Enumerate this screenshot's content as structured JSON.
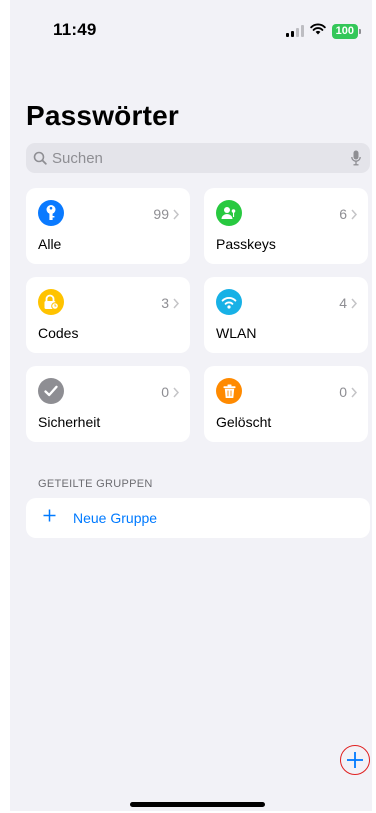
{
  "status_bar": {
    "time": "11:49",
    "battery": "100"
  },
  "title": "Passwörter",
  "search": {
    "placeholder": "Suchen"
  },
  "categories": [
    {
      "label": "Alle",
      "count": "99",
      "icon": "key-icon",
      "color": "#0a7aff"
    },
    {
      "label": "Passkeys",
      "count": "6",
      "icon": "passkey-person-icon",
      "color": "#28c940"
    },
    {
      "label": "Codes",
      "count": "3",
      "icon": "lock-clock-icon",
      "color": "#ffc300"
    },
    {
      "label": "WLAN",
      "count": "4",
      "icon": "wifi-icon",
      "color": "#17b1e6"
    },
    {
      "label": "Sicherheit",
      "count": "0",
      "icon": "checkmark-icon",
      "color": "#8e8e93"
    },
    {
      "label": "Gelöscht",
      "count": "0",
      "icon": "trash-icon",
      "color": "#ff8a00"
    }
  ],
  "shared_groups": {
    "header": "GETEILTE GRUPPEN",
    "new_group_label": "Neue Gruppe"
  },
  "colors": {
    "accent": "#007aff",
    "background": "#f2f2f7",
    "add_circle": "#e02020"
  }
}
